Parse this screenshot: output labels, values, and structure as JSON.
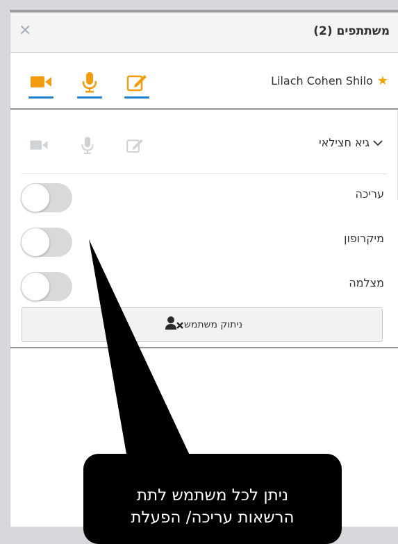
{
  "header": {
    "title": "משתתפים (2)",
    "close_icon": "close-icon"
  },
  "owner": {
    "name": "Lilach Cohen Shilo",
    "icons": [
      "star-icon",
      "video-icon",
      "microphone-icon",
      "edit-icon"
    ],
    "active_color": "#f39c12",
    "underline_color": "#1d80d0"
  },
  "user": {
    "name": "גיא חצילאי",
    "expanded": true,
    "icons": [
      "video-icon",
      "microphone-icon",
      "edit-icon"
    ],
    "muted_color": "#d0d3d6"
  },
  "permissions": [
    {
      "label": "עריכה",
      "enabled": false
    },
    {
      "label": "מיקרופון",
      "enabled": false
    },
    {
      "label": "מצלמה",
      "enabled": false
    }
  ],
  "disconnect_button": {
    "label": "ניתוק משתמש",
    "icon": "user-remove-icon"
  },
  "callout": {
    "line1": "ניתן לכל משתמש לתת",
    "line2": "הרשאות עריכה/ הפעלת"
  }
}
